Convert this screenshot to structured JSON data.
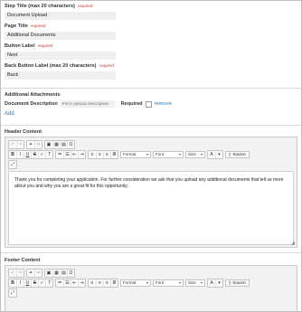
{
  "fields": {
    "step_title": {
      "label": "Step Title (max 20 characters)",
      "required": "required",
      "value": "Document Upload"
    },
    "page_title": {
      "label": "Page Title",
      "required": "required",
      "value": "Additional Documents"
    },
    "button_label": {
      "label": "Button Label",
      "required": "required",
      "value": "Next"
    },
    "back_button_label": {
      "label": "Back Button Label (max 20 characters)",
      "required": "required",
      "value": "Back"
    }
  },
  "attachments": {
    "heading": "Additional Attachments",
    "desc_label": "Document Description",
    "desc_placeholder": "Fill in upload description",
    "required_label": "Required",
    "remove_label": "remove",
    "add_label": "Add"
  },
  "header_content": {
    "title": "Header Content",
    "text": "Thank you for completing your application. For further consideration we ask that you upload any additional documents that tell us more about you and why you are a great fit for this opportunity."
  },
  "footer_content": {
    "title": "Footer Content"
  },
  "toolbar": {
    "format_label": "Format",
    "font_label": "Font",
    "size_label": "Size",
    "source_label": "Source"
  }
}
